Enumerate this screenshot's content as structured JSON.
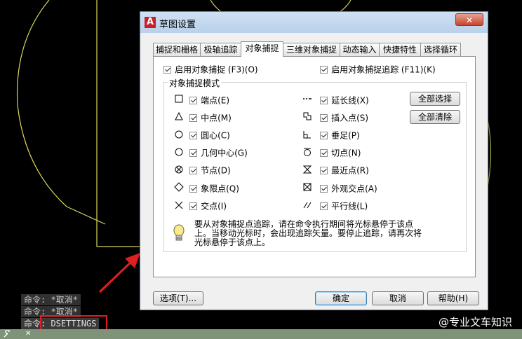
{
  "dialog": {
    "title": "草图设置",
    "close_label": "✕",
    "tabs": [
      {
        "label": "捕捉和栅格"
      },
      {
        "label": "极轴追踪"
      },
      {
        "label": "对象捕捉"
      },
      {
        "label": "三维对象捕捉"
      },
      {
        "label": "动态输入"
      },
      {
        "label": "快捷特性"
      },
      {
        "label": "选择循环"
      }
    ],
    "active_tab": "对象捕捉",
    "enable_osnap": {
      "label": "启用对象捕捉 (F3)(O)",
      "checked": true
    },
    "enable_tracking": {
      "label": "启用对象捕捉追踪 (F11)(K)",
      "checked": true
    },
    "group_title": "对象捕捉模式",
    "modes_left": [
      {
        "icon": "square-endpoint-icon",
        "label": "端点(E)",
        "checked": true
      },
      {
        "icon": "triangle-midpoint-icon",
        "label": "中点(M)",
        "checked": true
      },
      {
        "icon": "circle-center-icon",
        "label": "圆心(C)",
        "checked": true
      },
      {
        "icon": "circle-geometric-center-icon",
        "label": "几何中心(G)",
        "checked": true
      },
      {
        "icon": "circle-x-node-icon",
        "label": "节点(D)",
        "checked": true
      },
      {
        "icon": "diamond-quadrant-icon",
        "label": "象限点(Q)",
        "checked": true
      },
      {
        "icon": "x-intersection-icon",
        "label": "交点(I)",
        "checked": true
      }
    ],
    "modes_right": [
      {
        "icon": "dashed-extension-icon",
        "label": "延长线(X)",
        "checked": true
      },
      {
        "icon": "insert-squares-icon",
        "label": "插入点(S)",
        "checked": true
      },
      {
        "icon": "perpendicular-icon",
        "label": "垂足(P)",
        "checked": true
      },
      {
        "icon": "tangent-circle-icon",
        "label": "切点(N)",
        "checked": true
      },
      {
        "icon": "hourglass-nearest-icon",
        "label": "最近点(R)",
        "checked": true
      },
      {
        "icon": "box-x-apparent-icon",
        "label": "外观交点(A)",
        "checked": true
      },
      {
        "icon": "parallel-lines-icon",
        "label": "平行线(L)",
        "checked": true
      }
    ],
    "select_all_label": "全部选择",
    "clear_all_label": "全部清除",
    "info_icon": "lightbulb-icon",
    "info_text": "要从对象捕捉点追踪，请在命令执行期间将光标悬停于该点上。当移动光标时，会出现追踪矢量。要停止追踪，请再次将光标悬停于该点上。",
    "buttons": {
      "options": "选项(T)...",
      "ok": "确定",
      "cancel": "取消",
      "help": "帮助(H)"
    }
  },
  "command_history": [
    "命令: *取消*",
    "命令: *取消*"
  ],
  "command_current": "命令: DSETTINGS",
  "watermark": "@专业文车知识",
  "colors": {
    "cad_background": "#000000",
    "cad_lines": "#e6e36a",
    "highlight_red": "#e02020"
  }
}
